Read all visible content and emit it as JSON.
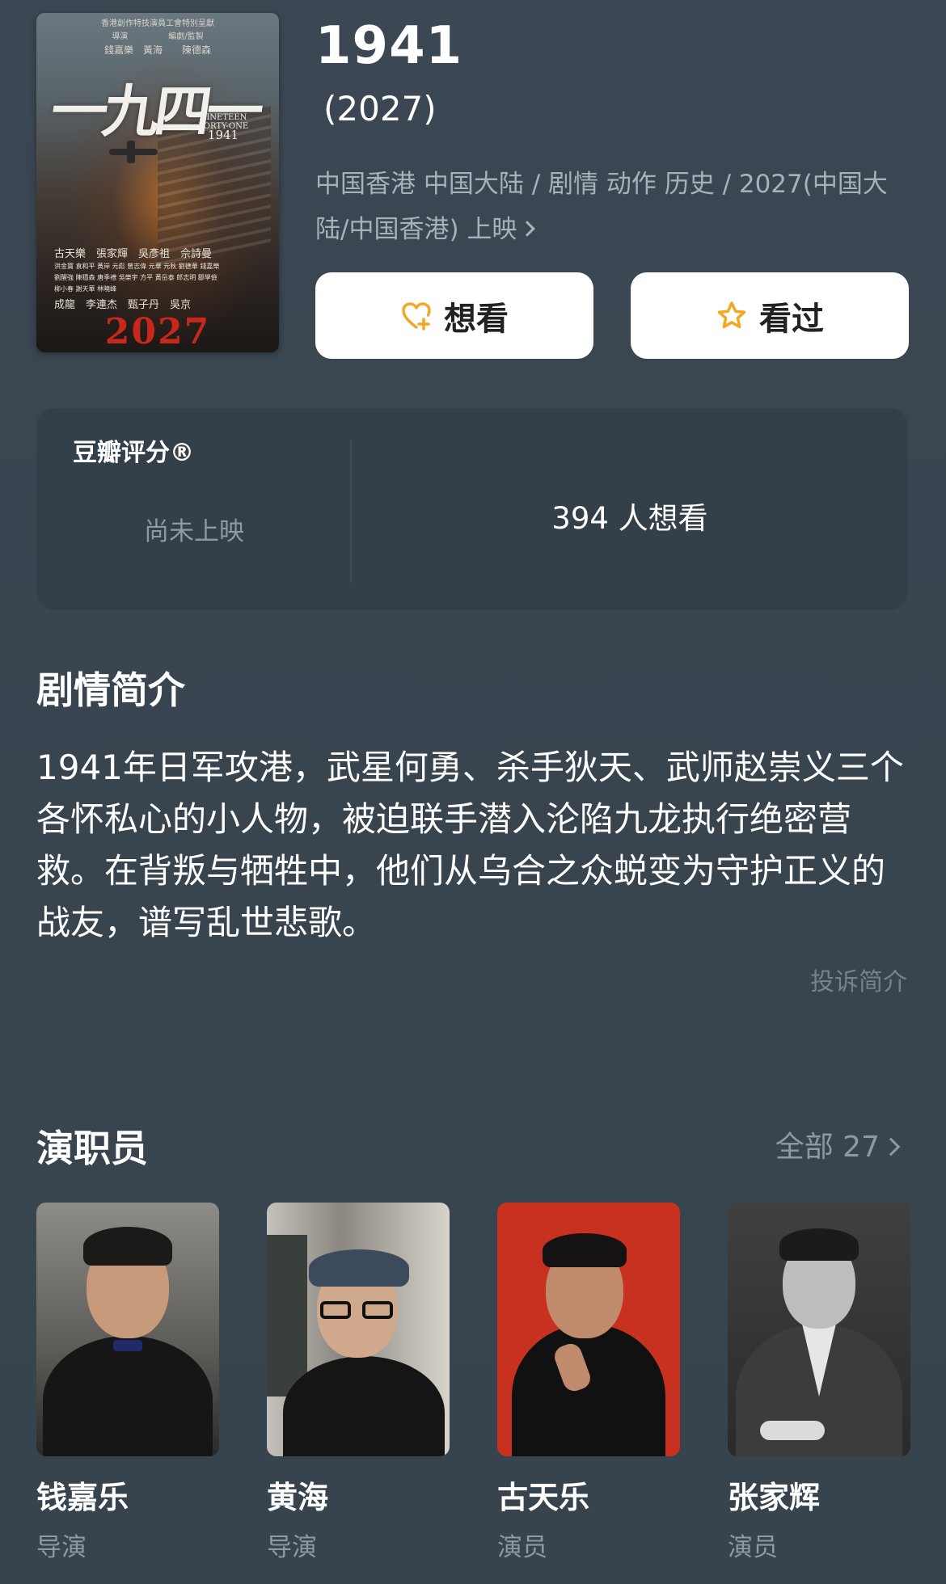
{
  "movie": {
    "title": "1941",
    "year": "(2027)",
    "meta_line": "中国香港 中国大陆 / 剧情 动作 历史 / 2027(中国大陆/中国香港) 上映"
  },
  "poster": {
    "credits_line1": "香港創作特技演員工會特別呈獻",
    "credits_line2": "導演　　　　　編劇/監製",
    "credits_line3": "錢嘉樂　黃海　　陳德森",
    "calligraphy": "一九四一",
    "subtitle": "NINETEEN FORTY-ONE",
    "subtitle_year": "1941",
    "cast_line1": "古天樂　張家輝　吳彥祖　佘詩曼",
    "cast_line2": "洪金寶 袁和平 黃岸 元彪 曾志偉 元華 元秋 劉德華 錢嘉樂",
    "cast_line3": "劉醒強 陳穩森 唐季禮 吳樂宇 方平 黃岳泰 郎志明 鄒學儉",
    "cast_line4": "柳小春 謝天華 林曉峰",
    "cast_line5": "成龍　李連杰　甄子丹　吳京",
    "year_big": "2027"
  },
  "actions": {
    "want_label": "想看",
    "seen_label": "看过"
  },
  "rating": {
    "label": "豆瓣评分®",
    "status": "尚未上映",
    "want_count": "394 人想看"
  },
  "synopsis": {
    "title": "剧情简介",
    "text": "1941年日军攻港，武星何勇、杀手狄天、武师赵崇义三个各怀私心的小人物，被迫联手潜入沦陷九龙执行绝密营救。在背叛与牺牲中，他们从乌合之众蜕变为守护正义的战友，谱写乱世悲歌。",
    "complaint_label": "投诉简介"
  },
  "cast": {
    "title": "演职员",
    "all_label": "全部 27",
    "members": [
      {
        "name": "钱嘉乐",
        "role": "导演"
      },
      {
        "name": "黄海",
        "role": "导演"
      },
      {
        "name": "古天乐",
        "role": "演员"
      },
      {
        "name": "张家辉",
        "role": "演员"
      }
    ]
  },
  "colors": {
    "background": "#3a4650",
    "card": "#33404a",
    "muted_text": "#a8b1b8",
    "button_bg": "#ffffff",
    "accent_orange": "#f5a623"
  }
}
